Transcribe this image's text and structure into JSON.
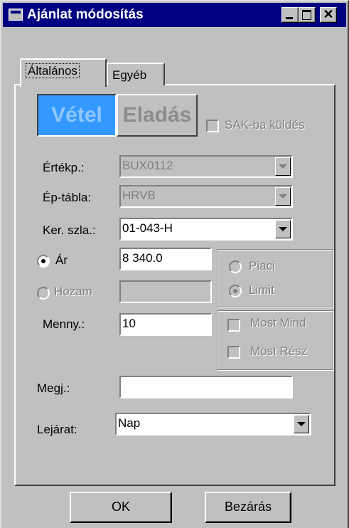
{
  "window": {
    "title": "Ajánlat módosítás",
    "close_glyph": "✕"
  },
  "tabs": [
    {
      "label": "Általános"
    },
    {
      "label": "Egyéb"
    }
  ],
  "side": {
    "buy": "Vétel",
    "sell": "Eladás"
  },
  "sak": {
    "label": "SAK-ba küldés",
    "checked": false
  },
  "form": {
    "security": {
      "label": "Értékp.:",
      "value": "BUX0112"
    },
    "board": {
      "label": "Ép-tábla:",
      "value": "HRVB"
    },
    "account": {
      "label": "Ker. szla.:",
      "value": "01-043-H"
    },
    "price": {
      "label": "Ár",
      "value": "8 340.0",
      "selected": true
    },
    "yield": {
      "label": "Hozam",
      "value": "",
      "selected": false
    },
    "quantity": {
      "label": "Menny.:",
      "value": "10"
    },
    "note": {
      "label": "Megj.:",
      "value": ""
    },
    "expiry": {
      "label": "Lejárat:",
      "value": "Nap"
    }
  },
  "price_type": {
    "market": "Piaci",
    "limit": "Limit",
    "selected": "Limit"
  },
  "qty_options": {
    "all_now": "Most Mind",
    "part_now": "Most Rész"
  },
  "buttons": {
    "ok": "OK",
    "close": "Bezárás"
  },
  "colors": {
    "titlebar": "#000080",
    "buy_active": "#3399ff",
    "face": "#c0c0c0"
  }
}
